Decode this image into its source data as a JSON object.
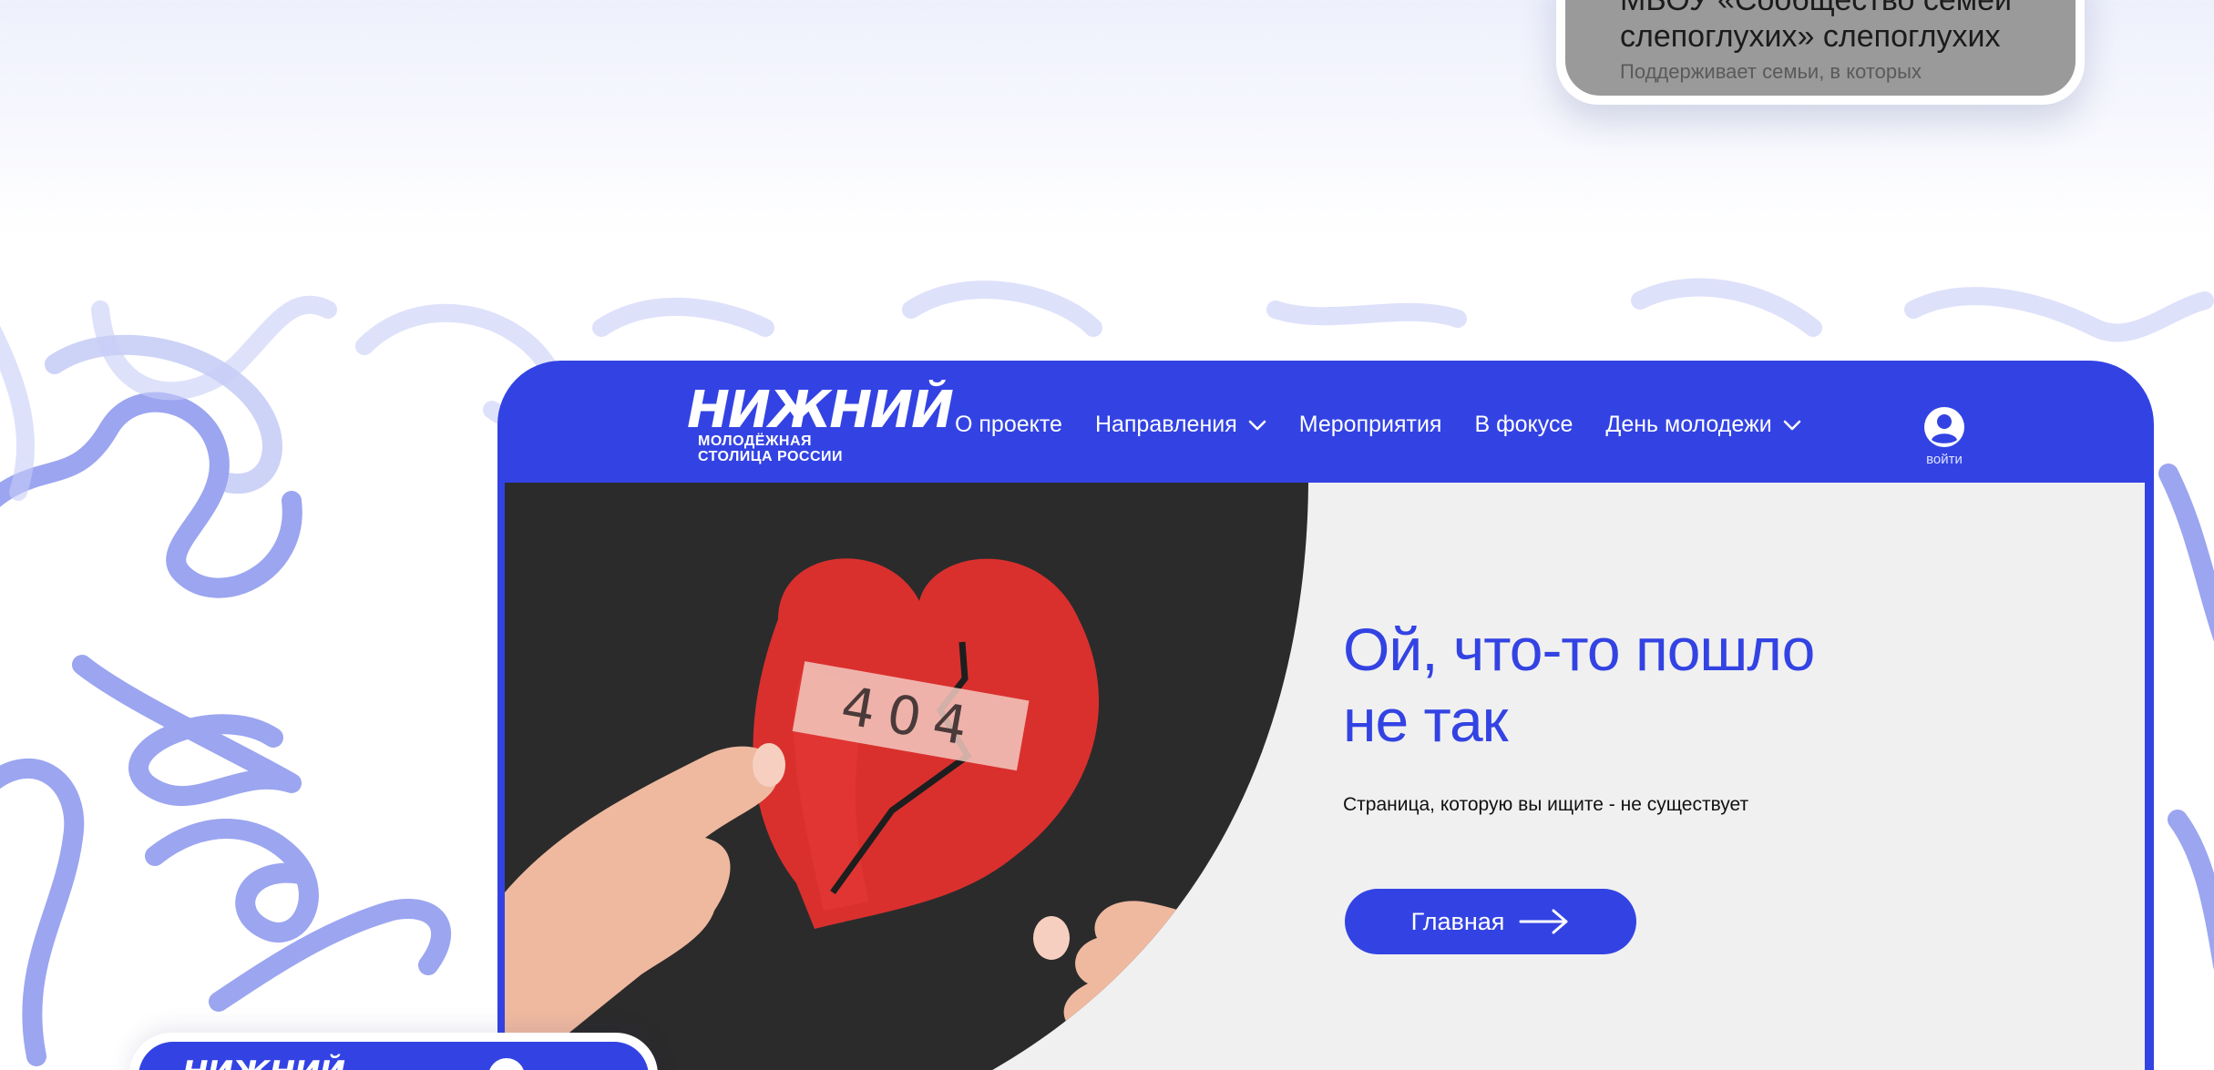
{
  "colors": {
    "brand_blue": "#3343e3",
    "screen_bg": "#f0f0f0",
    "doodle": "#8a95ee"
  },
  "phone_card": {
    "title_lines": [
      "МБОУ «Сообщество семей",
      "слепоглухих» слепоглухих"
    ],
    "subtitle": "Поддерживает семьи, в которых"
  },
  "header": {
    "logo": {
      "word": "НИЖНИЙ",
      "subtitle_lines": [
        "МОЛОДЁЖНАЯ",
        "СТОЛИЦА РОССИИ"
      ]
    },
    "nav": [
      {
        "label": "О проекте",
        "has_dropdown": false
      },
      {
        "label": "Направления",
        "has_dropdown": true
      },
      {
        "label": "Мероприятия",
        "has_dropdown": false
      },
      {
        "label": "В фокусе",
        "has_dropdown": false
      },
      {
        "label": "День молодежи",
        "has_dropdown": true
      }
    ],
    "login": {
      "icon": "user-icon",
      "label": "войти"
    }
  },
  "error": {
    "image": {
      "code": "404",
      "subject": "broken-heart-photo"
    },
    "title_lines": [
      "Ой, что-то пошло",
      "не так"
    ],
    "description": "Страница, которую вы ищите - не существует",
    "home_button": {
      "label": "Главная",
      "icon": "arrow-right-icon"
    }
  },
  "mini_card": {
    "logo": "НИЖНИЙ"
  }
}
